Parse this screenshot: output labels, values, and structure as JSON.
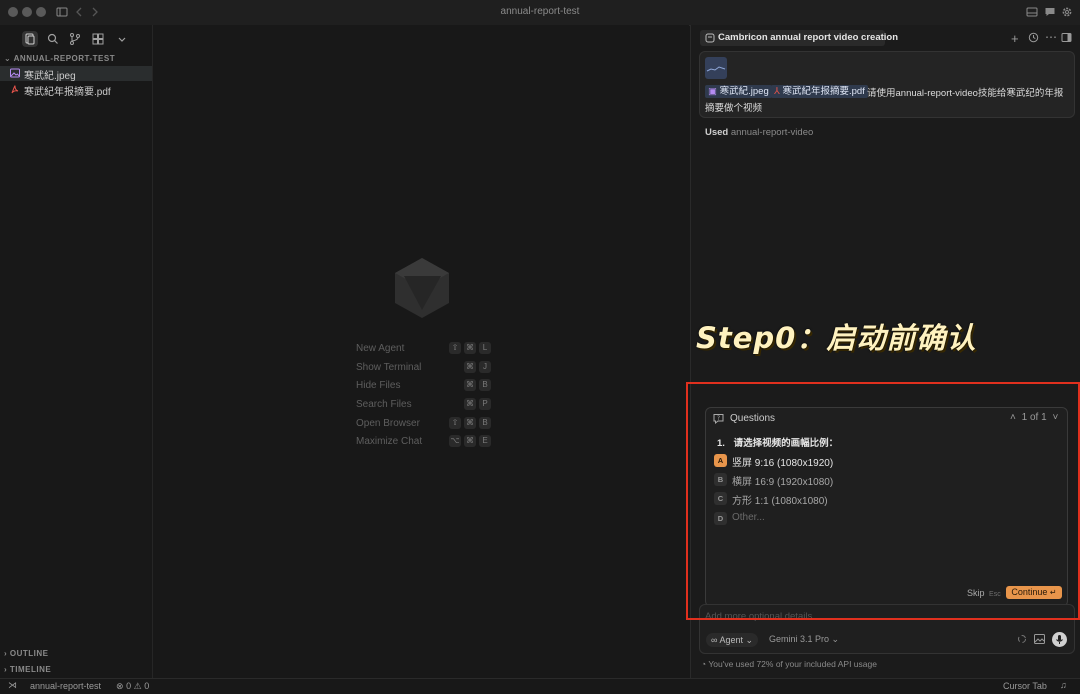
{
  "window": {
    "title": "annual-report-test"
  },
  "sidebar": {
    "project": "ANNUAL-REPORT-TEST",
    "files": [
      {
        "name": "寒武紀.jpeg",
        "icon": "image-icon"
      },
      {
        "name": "寒武紀年报摘要.pdf",
        "icon": "pdf-icon"
      }
    ],
    "outline": "OUTLINE",
    "timeline": "TIMELINE"
  },
  "editor": {
    "shortcuts": [
      {
        "label": "New Agent",
        "keys": [
          "⇧",
          "⌘",
          "L"
        ]
      },
      {
        "label": "Show Terminal",
        "keys": [
          "⌘",
          "J"
        ]
      },
      {
        "label": "Hide Files",
        "keys": [
          "⌘",
          "B"
        ]
      },
      {
        "label": "Search Files",
        "keys": [
          "⌘",
          "P"
        ]
      },
      {
        "label": "Open Browser",
        "keys": [
          "⇧",
          "⌘",
          "B"
        ]
      },
      {
        "label": "Maximize Chat",
        "keys": [
          "⌥",
          "⌘",
          "E"
        ]
      }
    ]
  },
  "chat": {
    "tab_title": "Cambricon annual report video creation",
    "message": {
      "chip1": "寒武紀.jpeg",
      "chip2": "寒武紀年报摘要.pdf",
      "text_line1": "请使用annual-report-video技能给寒武纪的年报",
      "text_line2": "摘要做个视频"
    },
    "used_prefix": "Used",
    "used_skill": "annual-report-video",
    "questions": {
      "header": "Questions",
      "pager": "1 of 1",
      "question_num": "1.",
      "question": "请选择视频的画幅比例：",
      "options": [
        {
          "letter": "A",
          "text": "竖屏 9:16 (1080x1920)",
          "selected": true
        },
        {
          "letter": "B",
          "text": "横屏 16:9 (1920x1080)",
          "selected": false
        },
        {
          "letter": "C",
          "text": "方形 1:1 (1080x1080)",
          "selected": false
        },
        {
          "letter": "D",
          "text": "Other...",
          "selected": false
        }
      ],
      "skip": "Skip",
      "skip_key": "Esc",
      "continue": "Continue",
      "continue_key": "↵"
    },
    "input_placeholder": "Add more optional details",
    "mode": "Agent",
    "model": "Gemini 3.1 Pro",
    "usage_note": "You've used 72% of your included API usage"
  },
  "overlay": {
    "step_title": "Step0：启动前确认"
  },
  "statusbar": {
    "project": "annual-report-test",
    "errors": "0",
    "warnings": "0",
    "right": "Cursor Tab"
  },
  "colors": {
    "accent": "#e8954b",
    "highlight": "#e0301e",
    "step_text": "#fff2bf"
  }
}
